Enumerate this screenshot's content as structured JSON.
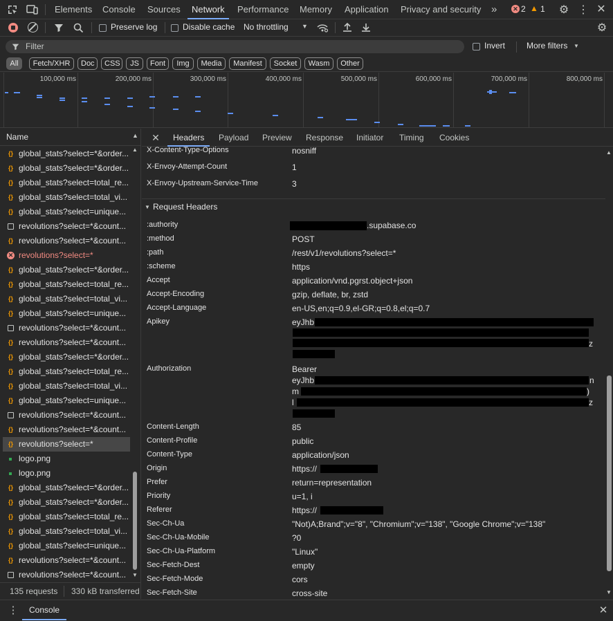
{
  "tabbar": {
    "tabs": [
      "Elements",
      "Console",
      "Sources",
      "Network",
      "Performance",
      "Memory",
      "Application",
      "Privacy and security"
    ],
    "more": "»",
    "errors_count": "2",
    "warnings_count": "1"
  },
  "toolbar": {
    "preserve_log": "Preserve log",
    "disable_cache": "Disable cache",
    "throttling": "No throttling"
  },
  "filter": {
    "placeholder": "Filter",
    "invert": "Invert",
    "more_filters": "More filters"
  },
  "chips": [
    "All",
    "Fetch/XHR",
    "Doc",
    "CSS",
    "JS",
    "Font",
    "Img",
    "Media",
    "Manifest",
    "Socket",
    "Wasm",
    "Other"
  ],
  "overview": {
    "ticks": [
      "100,000 ms",
      "200,000 ms",
      "300,000 ms",
      "400,000 ms",
      "500,000 ms",
      "600,000 ms",
      "700,000 ms",
      "800,000 ms"
    ]
  },
  "requests": {
    "header": "Name",
    "rows": [
      {
        "name": "global_stats?select=*&order...",
        "type": "xhr"
      },
      {
        "name": "global_stats?select=*&order...",
        "type": "xhr"
      },
      {
        "name": "global_stats?select=total_re...",
        "type": "xhr"
      },
      {
        "name": "global_stats?select=total_vi...",
        "type": "xhr"
      },
      {
        "name": "global_stats?select=unique...",
        "type": "xhr"
      },
      {
        "name": "revolutions?select=*&count...",
        "type": "doc"
      },
      {
        "name": "revolutions?select=*&count...",
        "type": "xhr"
      },
      {
        "name": "revolutions?select=*",
        "type": "error"
      },
      {
        "name": "global_stats?select=*&order...",
        "type": "xhr"
      },
      {
        "name": "global_stats?select=total_re...",
        "type": "xhr"
      },
      {
        "name": "global_stats?select=total_vi...",
        "type": "xhr"
      },
      {
        "name": "global_stats?select=unique...",
        "type": "xhr"
      },
      {
        "name": "revolutions?select=*&count...",
        "type": "doc"
      },
      {
        "name": "revolutions?select=*&count...",
        "type": "xhr"
      },
      {
        "name": "global_stats?select=*&order...",
        "type": "xhr"
      },
      {
        "name": "global_stats?select=total_re...",
        "type": "xhr"
      },
      {
        "name": "global_stats?select=total_vi...",
        "type": "xhr"
      },
      {
        "name": "global_stats?select=unique...",
        "type": "xhr"
      },
      {
        "name": "revolutions?select=*&count...",
        "type": "doc"
      },
      {
        "name": "revolutions?select=*&count...",
        "type": "xhr"
      },
      {
        "name": "revolutions?select=*",
        "type": "xhr",
        "selected": true
      },
      {
        "name": "logo.png",
        "type": "img"
      },
      {
        "name": "logo.png",
        "type": "img"
      },
      {
        "name": "global_stats?select=*&order...",
        "type": "xhr"
      },
      {
        "name": "global_stats?select=*&order...",
        "type": "xhr"
      },
      {
        "name": "global_stats?select=total_re...",
        "type": "xhr"
      },
      {
        "name": "global_stats?select=total_vi...",
        "type": "xhr"
      },
      {
        "name": "global_stats?select=unique...",
        "type": "xhr"
      },
      {
        "name": "revolutions?select=*&count...",
        "type": "xhr"
      },
      {
        "name": "revolutions?select=*&count...",
        "type": "doc"
      }
    ],
    "summary_requests": "135 requests",
    "summary_transferred": "330 kB transferred"
  },
  "details": {
    "tabs": [
      "Headers",
      "Payload",
      "Preview",
      "Response",
      "Initiator",
      "Timing",
      "Cookies"
    ],
    "response_headers": [
      {
        "k": "X-Content-Type-Options",
        "v": "nosniff"
      },
      {
        "k": "X-Envoy-Attempt-Count",
        "v": "1"
      },
      {
        "k": "X-Envoy-Upstream-Service-Time",
        "v": "3"
      }
    ],
    "request_section": "Request Headers",
    "authority_key": ":authority",
    "authority_suffix": ".supabase.co",
    "method_key": ":method",
    "method": "POST",
    "path_key": ":path",
    "path": "/rest/v1/revolutions?select=*",
    "scheme_key": ":scheme",
    "scheme": "https",
    "accept_key": "Accept",
    "accept": "application/vnd.pgrst.object+json",
    "accept_encoding_key": "Accept-Encoding",
    "accept_encoding": "gzip, deflate, br, zstd",
    "accept_language_key": "Accept-Language",
    "accept_language": "en-US,en;q=0.9,el-GR;q=0.8,el;q=0.7",
    "apikey_key": "Apikey",
    "apikey_prefix": "eyJhb",
    "apikey_tail": "z",
    "authorization_key": "Authorization",
    "authorization_bearer": "Bearer",
    "authorization_prefix": "eyJhb",
    "authorization_tail1": "n",
    "authorization_m": "m",
    "authorization_paren": ")",
    "authorization_l": "l",
    "authorization_z": "z",
    "content_length_key": "Content-Length",
    "content_length": "85",
    "content_profile_key": "Content-Profile",
    "content_profile": "public",
    "content_type_key": "Content-Type",
    "content_type": "application/json",
    "origin_key": "Origin",
    "origin_prefix": "https://",
    "prefer_key": "Prefer",
    "prefer": "return=representation",
    "priority_key": "Priority",
    "priority": "u=1, i",
    "referer_key": "Referer",
    "referer_prefix": "https://",
    "sec_ch_ua_key": "Sec-Ch-Ua",
    "sec_ch_ua": "\"Not)A;Brand\";v=\"8\", \"Chromium\";v=\"138\", \"Google Chrome\";v=\"138\"",
    "sec_ch_ua_mobile_key": "Sec-Ch-Ua-Mobile",
    "sec_ch_ua_mobile": "?0",
    "sec_ch_ua_platform_key": "Sec-Ch-Ua-Platform",
    "sec_ch_ua_platform": "\"Linux\"",
    "sec_fetch_dest_key": "Sec-Fetch-Dest",
    "sec_fetch_dest": "empty",
    "sec_fetch_mode_key": "Sec-Fetch-Mode",
    "sec_fetch_mode": "cors",
    "sec_fetch_site_key": "Sec-Fetch-Site",
    "sec_fetch_site": "cross-site"
  },
  "drawer": {
    "tab": "Console"
  },
  "colors": {
    "accent": "#7cacf8",
    "error": "#f28b82",
    "warning": "#f29900",
    "waterfall": "#5b8ef0"
  }
}
